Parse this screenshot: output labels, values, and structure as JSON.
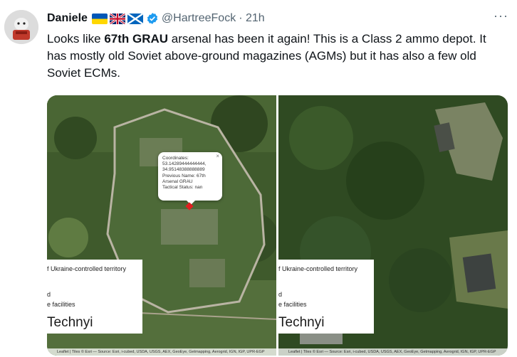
{
  "author": {
    "name": "Daniele",
    "handle": "@HartreeFock",
    "time": "· 21h",
    "flags": [
      "ukraine-flag",
      "uk-flag",
      "scotland-flag"
    ],
    "verified_icon": "verified-badge-icon"
  },
  "more_label": "···",
  "tweet": {
    "p1": "Looks like ",
    "bold": "67th GRAU",
    "p2": " arsenal has been it again! This is a Class 2 ammo depot. It has mostly old Soviet above-ground magazines (AGMs) but it has also a few old Soviet ECMs."
  },
  "map_left": {
    "popup": {
      "close": "×",
      "lines": [
        "Coordinates:",
        "53.14289444444444,",
        "34.95148388888889",
        "Previous Name: 67th",
        "Arsenal GRAU",
        "Tactical Status: nan"
      ]
    },
    "legend": {
      "line1": "f Ukraine-controlled territory",
      "line2": "d",
      "line3": "e facilities",
      "brand": "Technyi"
    },
    "attribution": "Leaflet | Tiles © Esri — Source: Esri, i-cubed, USDA, USGS, AEX, GeoEye, Getmapping, Aerogrid, IGN, IGP, UPR-EGP"
  },
  "map_right": {
    "legend": {
      "line1": "f Ukraine-controlled territory",
      "line2": "d",
      "line3": "e facilities",
      "brand": "Technyi"
    },
    "attribution": "Leaflet | Tiles © Esri — Source: Esri, i-cubed, USDA, USGS, AEX, GeoEye, Getmapping, Aerogrid, IGN, IGP, UPR-EGP"
  },
  "colors": {
    "text": "#0f1419",
    "secondary": "#536471",
    "verified": "#1d9bf0",
    "marker": "#e02020"
  }
}
